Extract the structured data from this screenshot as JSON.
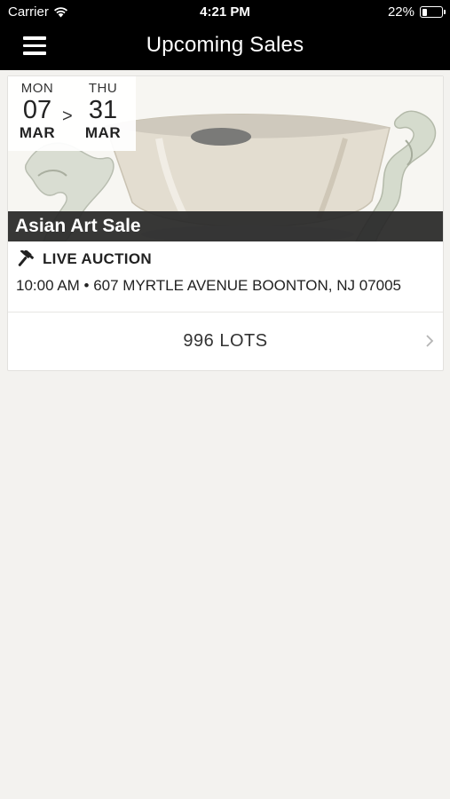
{
  "status_bar": {
    "carrier": "Carrier",
    "time": "4:21 PM",
    "battery": "22%",
    "icons": [
      "wifi-icon",
      "battery-icon"
    ]
  },
  "nav": {
    "title": "Upcoming Sales",
    "menu_icon": "menu-icon"
  },
  "sales": [
    {
      "start": {
        "dow": "MON",
        "day": "07",
        "month": "MAR"
      },
      "separator": ">",
      "end": {
        "dow": "THU",
        "day": "31",
        "month": "MAR"
      },
      "title": "Asian Art Sale",
      "type_icon": "gavel-icon",
      "type": "LIVE AUCTION",
      "details": "10:00 AM • 607 MYRTLE AVENUE BOONTON, NJ 07005",
      "lots": "996 LOTS",
      "chevron_icon": "chevron-right-icon"
    }
  ],
  "colors": {
    "bar_bg": "#000000",
    "page_bg": "#f3f2ef",
    "title_overlay": "#282828"
  }
}
